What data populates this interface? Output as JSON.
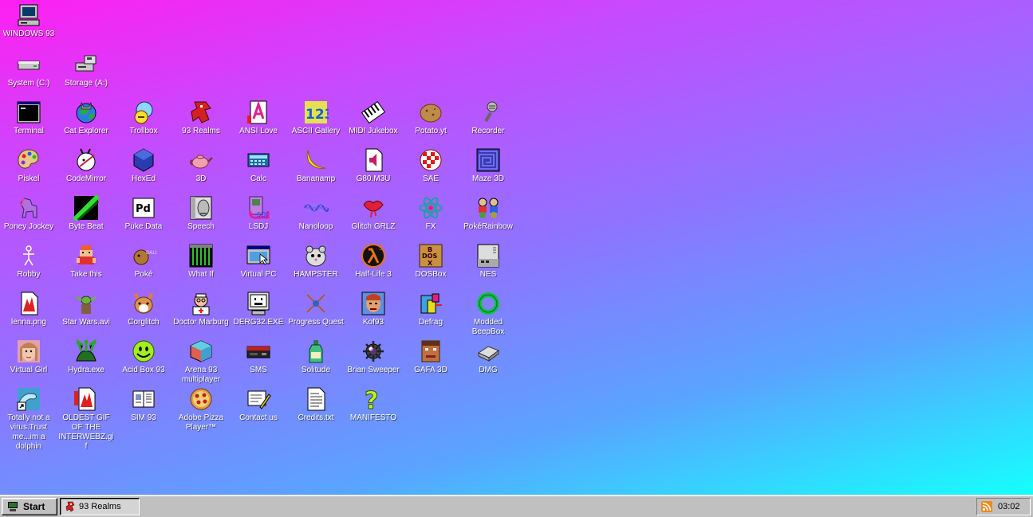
{
  "desktop": {
    "background_gradient": [
      "#ff1ff2",
      "#c24dff",
      "#8f73ff",
      "#5aa3ff",
      "#15ffff"
    ],
    "icons": [
      {
        "name": "windows93-icon",
        "label": "WINDOWS 93",
        "icon": "computer-icon",
        "col": 0,
        "row": 0
      },
      {
        "name": "system-c-icon",
        "label": "System (C:)",
        "icon": "hard-drive-icon",
        "col": 0,
        "row": 1
      },
      {
        "name": "storage-a-icon",
        "label": "Storage (A:)",
        "icon": "floppy-drive-icon",
        "col": 1,
        "row": 1
      },
      {
        "name": "terminal-icon",
        "label": "Terminal",
        "icon": "terminal-icon",
        "col": 0,
        "row": 2
      },
      {
        "name": "cat-explorer-icon",
        "label": "Cat Explorer",
        "icon": "globe-cat-icon",
        "col": 1,
        "row": 2
      },
      {
        "name": "trollbox-icon",
        "label": "Trollbox",
        "icon": "chat-bubble-icon",
        "col": 2,
        "row": 2
      },
      {
        "name": "93-realms-icon",
        "label": "93 Realms",
        "icon": "dragon-icon",
        "col": 3,
        "row": 2
      },
      {
        "name": "ansi-love-icon",
        "label": "ANSI Love",
        "icon": "letter-a-icon",
        "col": 4,
        "row": 2
      },
      {
        "name": "ascii-gallery-icon",
        "label": "ASCII Gallery",
        "icon": "numbers-123-icon",
        "col": 5,
        "row": 2
      },
      {
        "name": "midi-jukebox-icon",
        "label": "MIDI Jukebox",
        "icon": "piano-keys-icon",
        "col": 6,
        "row": 2
      },
      {
        "name": "potato-yt-icon",
        "label": "Potato.yt",
        "icon": "potato-icon",
        "col": 7,
        "row": 2
      },
      {
        "name": "recorder-icon",
        "label": "Recorder",
        "icon": "microphone-icon",
        "col": 8,
        "row": 2
      },
      {
        "name": "piskel-icon",
        "label": "Piskel",
        "icon": "palette-icon",
        "col": 0,
        "row": 3
      },
      {
        "name": "codemirror-icon",
        "label": "CodeMirror",
        "icon": "rabbit-icon",
        "col": 1,
        "row": 3
      },
      {
        "name": "hexed-icon",
        "label": "HexEd",
        "icon": "hexagon-icon",
        "col": 2,
        "row": 3
      },
      {
        "name": "3d-icon",
        "label": "3D",
        "icon": "teapot-icon",
        "col": 3,
        "row": 3
      },
      {
        "name": "calc-icon",
        "label": "Calc",
        "icon": "calculator-icon",
        "col": 4,
        "row": 3
      },
      {
        "name": "bananamp-icon",
        "label": "Bananamp",
        "icon": "banana-icon",
        "col": 5,
        "row": 3
      },
      {
        "name": "g80-m3u-icon",
        "label": "G80.M3U",
        "icon": "audio-file-icon",
        "col": 6,
        "row": 3
      },
      {
        "name": "sae-icon",
        "label": "SAE",
        "icon": "checker-ball-icon",
        "col": 7,
        "row": 3
      },
      {
        "name": "maze-3d-icon",
        "label": "Maze 3D",
        "icon": "maze-icon",
        "col": 8,
        "row": 3
      },
      {
        "name": "poney-jockey-icon",
        "label": "Poney Jockey",
        "icon": "pony-icon",
        "col": 0,
        "row": 4
      },
      {
        "name": "byte-beat-icon",
        "label": "Byte Beat",
        "icon": "waveform-green-icon",
        "col": 1,
        "row": 4
      },
      {
        "name": "puke-data-icon",
        "label": "Puke Data",
        "icon": "pd-icon",
        "col": 2,
        "row": 4
      },
      {
        "name": "speech-icon",
        "label": "Speech",
        "icon": "face-speech-icon",
        "col": 3,
        "row": 4
      },
      {
        "name": "lsdj-icon",
        "label": "LSDJ",
        "icon": "gameboy-icon",
        "col": 4,
        "row": 4
      },
      {
        "name": "nanoloop-icon",
        "label": "Nanoloop",
        "icon": "sine-wave-icon",
        "col": 5,
        "row": 4
      },
      {
        "name": "glitch-grlz-icon",
        "label": "Glitch GRLZ",
        "icon": "lips-icon",
        "col": 6,
        "row": 4
      },
      {
        "name": "fx-icon",
        "label": "FX",
        "icon": "atom-icon",
        "col": 7,
        "row": 4
      },
      {
        "name": "pokerainbow-icon",
        "label": "PokéRainbow",
        "icon": "trainers-icon",
        "col": 8,
        "row": 4
      },
      {
        "name": "robby-icon",
        "label": "Robby",
        "icon": "stick-figure-icon",
        "col": 0,
        "row": 5
      },
      {
        "name": "take-this-icon",
        "label": "Take this",
        "icon": "pixel-character-icon",
        "col": 1,
        "row": 5
      },
      {
        "name": "pokeball-stuff-icon",
        "label": "Poké",
        "icon": "pokemon-pixel-icon",
        "col": 2,
        "row": 5
      },
      {
        "name": "what-if-icon",
        "label": "What If",
        "icon": "green-grid-icon",
        "col": 3,
        "row": 5
      },
      {
        "name": "virtual-pc-icon",
        "label": "Virtual PC",
        "icon": "window-cursor-icon",
        "col": 4,
        "row": 5
      },
      {
        "name": "hampster-icon",
        "label": "HAMPSTER",
        "icon": "hamster-icon",
        "col": 5,
        "row": 5
      },
      {
        "name": "half-life-3-icon",
        "label": "Half-Life 3",
        "icon": "lambda-icon",
        "col": 6,
        "row": 5
      },
      {
        "name": "dosbox-icon",
        "label": "DOSBox",
        "icon": "dosbox-icon",
        "col": 7,
        "row": 5
      },
      {
        "name": "nes-icon",
        "label": "NES",
        "icon": "nes-console-icon",
        "col": 8,
        "row": 5
      },
      {
        "name": "lenna-png-icon",
        "label": "lenna.png",
        "icon": "image-file-icon",
        "col": 0,
        "row": 6
      },
      {
        "name": "star-wars-avi-icon",
        "label": "Star Wars.avi",
        "icon": "yoda-icon",
        "col": 1,
        "row": 6
      },
      {
        "name": "corglitch-icon",
        "label": "Corglitch",
        "icon": "corgi-icon",
        "col": 2,
        "row": 6
      },
      {
        "name": "doctor-marburg-icon",
        "label": "Doctor Marburg",
        "icon": "doctor-icon",
        "col": 3,
        "row": 6
      },
      {
        "name": "derg32-exe-icon",
        "label": "DERG32.EXE",
        "icon": "monitor-face-icon",
        "col": 4,
        "row": 6
      },
      {
        "name": "progress-quest-icon",
        "label": "Progress Quest",
        "icon": "crossed-swords-icon",
        "col": 5,
        "row": 6
      },
      {
        "name": "kof93-icon",
        "label": "Kof93",
        "icon": "fighter-portrait-icon",
        "col": 6,
        "row": 6
      },
      {
        "name": "defrag-icon",
        "label": "Defrag",
        "icon": "defrag-blocks-icon",
        "col": 7,
        "row": 6
      },
      {
        "name": "modded-beepbox-icon",
        "label": "Modded BeepBox",
        "icon": "green-ring-icon",
        "col": 8,
        "row": 6
      },
      {
        "name": "virtual-girl-icon",
        "label": "Virtual Girl",
        "icon": "portrait-girl-icon",
        "col": 0,
        "row": 7
      },
      {
        "name": "hydra-exe-icon",
        "label": "Hydra.exe",
        "icon": "hydra-icon",
        "col": 1,
        "row": 7
      },
      {
        "name": "acid-box-93-icon",
        "label": "Acid Box 93",
        "icon": "smiley-icon",
        "col": 2,
        "row": 7
      },
      {
        "name": "arena-93-multiplayer-icon",
        "label": "Arena 93 multiplayer",
        "icon": "cube-icon",
        "col": 3,
        "row": 7
      },
      {
        "name": "sms-icon",
        "label": "SMS",
        "icon": "sms-console-icon",
        "col": 4,
        "row": 7
      },
      {
        "name": "solitude-icon",
        "label": "Solitude",
        "icon": "bottle-icon",
        "col": 5,
        "row": 7
      },
      {
        "name": "brian-sweeper-icon",
        "label": "Brian Sweeper",
        "icon": "mine-icon",
        "col": 6,
        "row": 7
      },
      {
        "name": "gafa-3d-icon",
        "label": "GAFA 3D",
        "icon": "doomguy-icon",
        "col": 7,
        "row": 7
      },
      {
        "name": "dmg-icon",
        "label": "DMG",
        "icon": "disk-drive-icon",
        "col": 8,
        "row": 7
      },
      {
        "name": "dolphin-virus-icon",
        "label": "Totally not a virus.Trust me...im a dolphin",
        "icon": "dolphin-shortcut-icon",
        "col": 0,
        "row": 8
      },
      {
        "name": "oldest-gif-icon",
        "label": "OLDEST GIF OF THE INTERWEBZ.gif",
        "icon": "gif-file-icon",
        "col": 1,
        "row": 8
      },
      {
        "name": "sim-93-icon",
        "label": "SIM 93",
        "icon": "manual-icon",
        "col": 2,
        "row": 8
      },
      {
        "name": "adobe-pizza-player-icon",
        "label": "Adobe Pizza Player™",
        "icon": "pizza-icon",
        "col": 3,
        "row": 8
      },
      {
        "name": "contact-us-icon",
        "label": "Contact us",
        "icon": "letter-pen-icon",
        "col": 4,
        "row": 8
      },
      {
        "name": "credits-txt-icon",
        "label": "Credits.txt",
        "icon": "text-file-icon",
        "col": 5,
        "row": 8
      },
      {
        "name": "manifesto-icon",
        "label": "MANIFESTO",
        "icon": "question-mark-icon",
        "col": 6,
        "row": 8
      }
    ]
  },
  "taskbar": {
    "start_label": "Start",
    "tasks": [
      {
        "label": "93 Realms",
        "icon": "dragon-icon"
      }
    ],
    "tray": {
      "rss_icon": "rss-icon",
      "clock": "03:02"
    }
  }
}
